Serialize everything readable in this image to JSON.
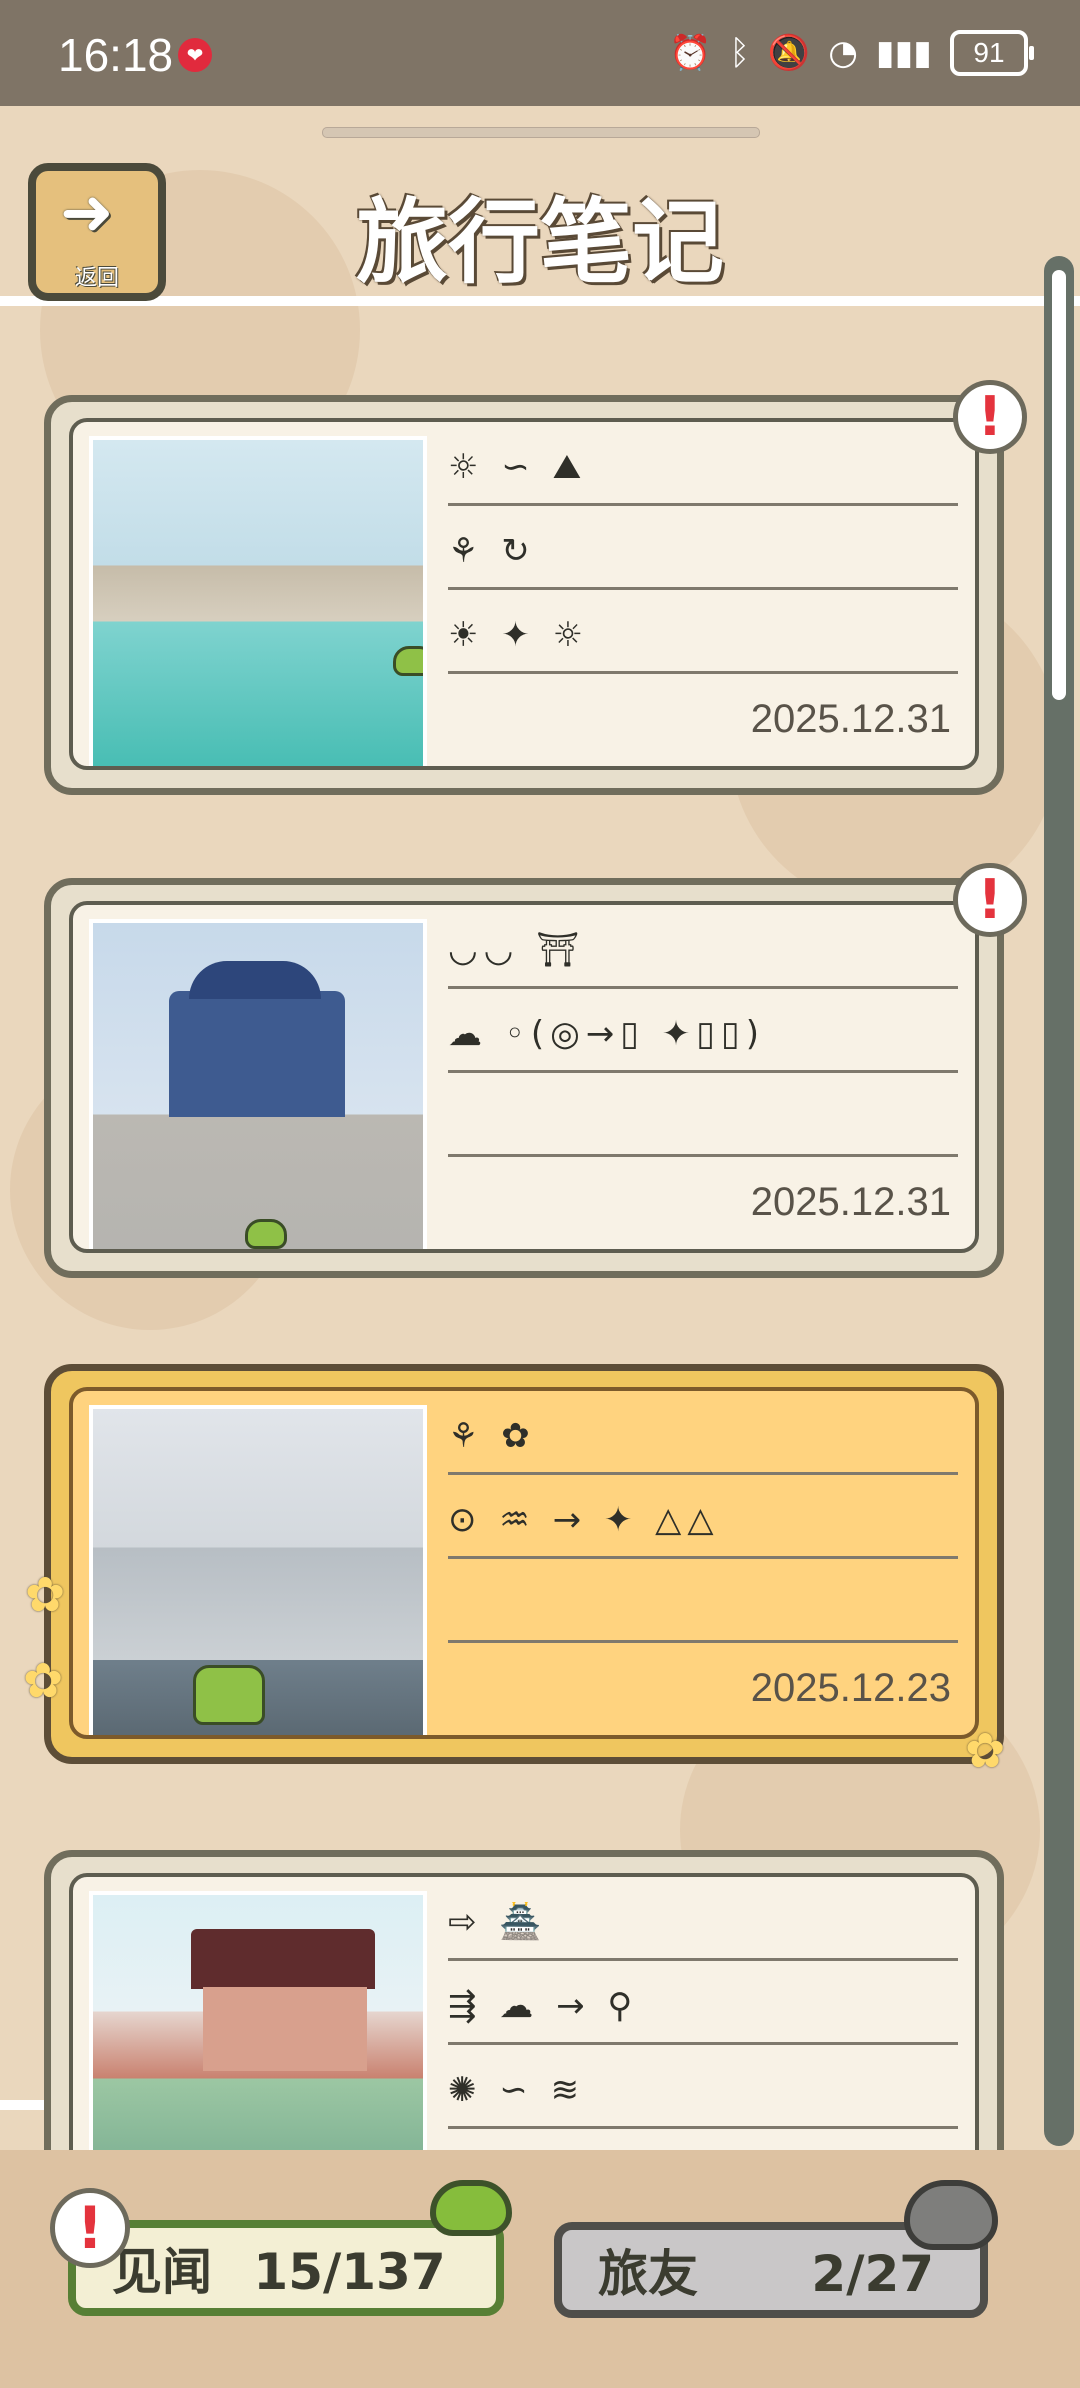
{
  "status_bar": {
    "time": "16:18",
    "battery": "91",
    "icons": [
      "alarm-icon",
      "bluetooth-icon",
      "mute-icon",
      "wifi-icon",
      "4g-signal-icon",
      "battery-icon"
    ]
  },
  "header": {
    "title": "旅行笔记",
    "back_label": "返回"
  },
  "cards": [
    {
      "date": "2025.12.31",
      "rows": [
        "☼ ∽ ⛰",
        "⚘ ↻",
        "☀ ✦ ☼"
      ]
    },
    {
      "date": "2025.12.31",
      "rows": [
        "◡◡ ⛩",
        "☁ ◦(◎→▯ ✦▯▯)",
        ""
      ]
    },
    {
      "date": "2025.12.23",
      "rows": [
        "⚘ ✿",
        "⊙ ♒ → ✦ △△",
        ""
      ]
    },
    {
      "date": "",
      "rows": [
        "⇨ 🏯",
        "⇶ ☁ → ⚲",
        "✺ ∽ ≋"
      ]
    }
  ],
  "footer": {
    "left_label": "见闻",
    "left_value": "15/137",
    "right_label": "旅友",
    "right_value": "2/27",
    "alert_mark": "!"
  },
  "alerts": [
    "!",
    "!"
  ]
}
